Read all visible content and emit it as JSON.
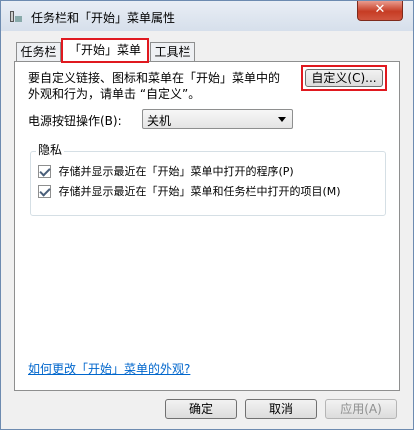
{
  "window": {
    "title": "任务栏和「开始」菜单属性",
    "close_label": "✕"
  },
  "tabs": [
    {
      "label": "任务栏",
      "selected": false
    },
    {
      "label": "「开始」菜单",
      "selected": true
    },
    {
      "label": "工具栏",
      "selected": false
    }
  ],
  "start_menu": {
    "description_line1": "要自定义链接、图标和菜单在「开始」菜单中的",
    "description_line2": "外观和行为，请单击 “自定义”。",
    "customize_label": "自定义(C)...",
    "power_label": "电源按钮操作(B):",
    "power_value": "关机"
  },
  "privacy": {
    "title": "隐私",
    "option1": {
      "label": "存储并显示最近在「开始」菜单中打开的程序(P)",
      "checked": true
    },
    "option2": {
      "label": "存储并显示最近在「开始」菜单和任务栏中打开的项目(M)",
      "checked": true
    }
  },
  "help_link": "如何更改「开始」菜单的外观?",
  "buttons": {
    "ok": "确定",
    "cancel": "取消",
    "apply": "应用(A)"
  },
  "colors": {
    "highlight_border": "#e0191f",
    "link": "#0066cc"
  }
}
